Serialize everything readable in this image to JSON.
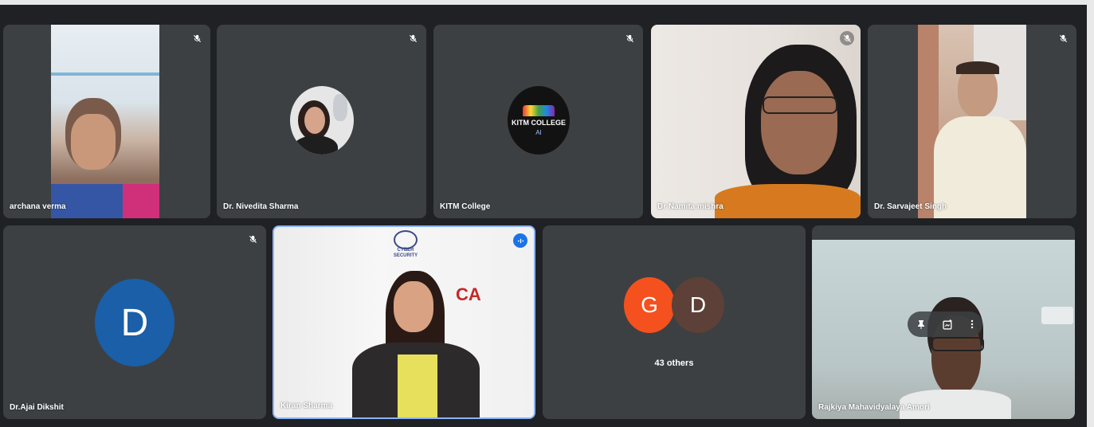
{
  "tiles": {
    "archana": {
      "name": "archana verma",
      "muted": true
    },
    "nivedita": {
      "name": "Dr. Nivedita Sharma",
      "muted": true
    },
    "kitm": {
      "name": "KITM College",
      "muted": true,
      "logo_title": "KITM COLLEGE",
      "logo_sub": "AI"
    },
    "namita": {
      "name": "Dr Namita mishra",
      "muted": true
    },
    "sarvajeet": {
      "name": "Dr. Sarvajeet Singh",
      "muted": true
    },
    "ajai": {
      "name": "Dr.Ajai Dikshit",
      "muted": true,
      "avatar_letter": "D",
      "avatar_color": "#1a5fa8"
    },
    "kiran": {
      "name": "Kiran Sharma",
      "speaking": true,
      "background_text": "CYBER SECURITY",
      "background_logo": "CA"
    },
    "others": {
      "label": "43 others",
      "avatars": [
        {
          "letter": "G",
          "color": "#f4511e"
        },
        {
          "letter": "D",
          "color": "#5d4037"
        }
      ]
    },
    "rajkiya": {
      "name": "Rajkiya Mahavidyalaya Amori"
    }
  },
  "colors": {
    "tile_bg": "#3c4043",
    "page_bg": "#202124",
    "speaking_border": "#8ab4f8"
  }
}
